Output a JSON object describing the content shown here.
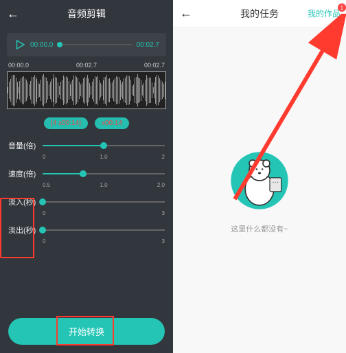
{
  "left": {
    "title": "音频剪辑",
    "player": {
      "current": "00:00.0",
      "total": "00:02.7"
    },
    "timeline": {
      "start": "00:00.0",
      "mid": "00:02.7",
      "end": "00:02.7"
    },
    "presets": {
      "a": "[4 x00:14]",
      "b": "x00:14"
    },
    "sliders": {
      "volume": {
        "label": "音量(倍)",
        "min": "0",
        "mid": "1.0",
        "max": "2",
        "value_pct": 50
      },
      "speed": {
        "label": "速度(倍)",
        "min": "0.5",
        "mid": "1.0",
        "max": "2.0",
        "value_pct": 33
      },
      "fadein": {
        "label": "淡入(秒)",
        "min": "0",
        "mid": "",
        "max": "3",
        "value_pct": 0
      },
      "fadeout": {
        "label": "淡出(秒)",
        "min": "0",
        "mid": "",
        "max": "3",
        "value_pct": 0
      }
    },
    "convert": "开始转换"
  },
  "right": {
    "title": "我的任务",
    "my_works": "我的作品",
    "badge": "1",
    "empty": "这里什么都没有~"
  }
}
